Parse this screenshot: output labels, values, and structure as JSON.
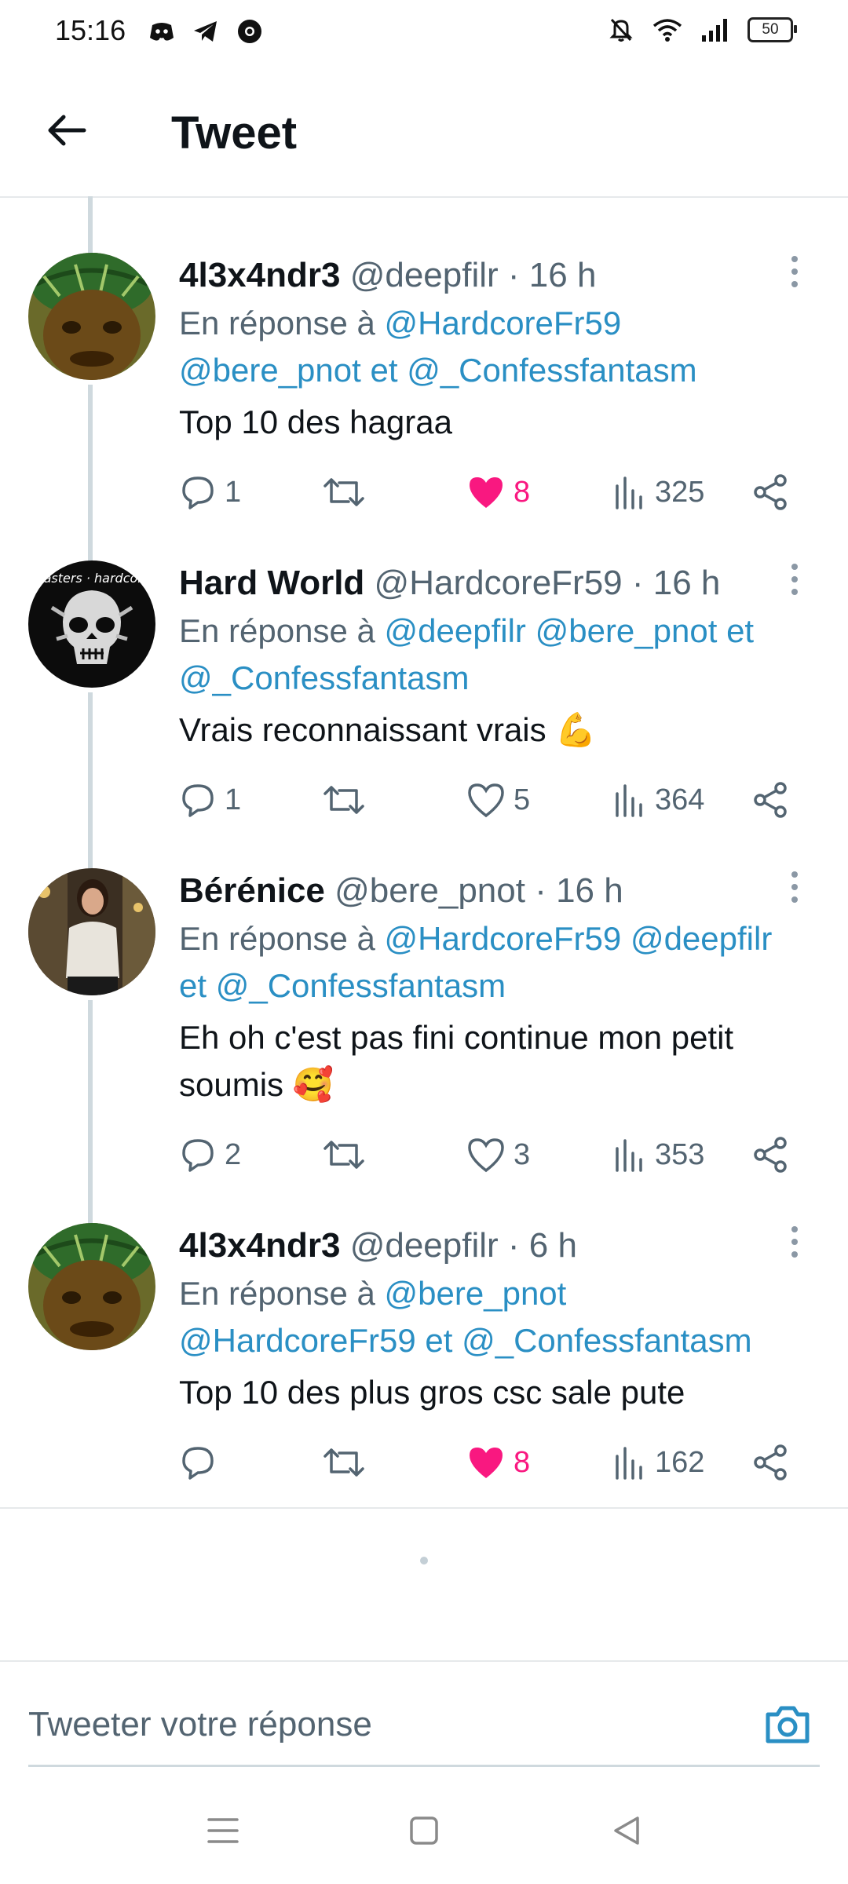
{
  "status_bar": {
    "time": "15:16",
    "battery": "50"
  },
  "header": {
    "title": "Tweet"
  },
  "tweets": [
    {
      "name": "4l3x4ndr3",
      "handle": "@deepfilr",
      "time": "· 16 h",
      "reply_prefix": "En réponse à",
      "reply_links": [
        "@HardcoreFr59",
        "@bere_pnot",
        "et",
        "@_Confessfantasm"
      ],
      "text": "Top 10 des hagraa",
      "emoji": "",
      "replies": "1",
      "likes": "8",
      "liked": true,
      "views": "325"
    },
    {
      "name": "Hard World",
      "handle": "@HardcoreFr59",
      "time": "· 16 h",
      "reply_prefix": "En réponse à",
      "reply_links": [
        "@deepfilr",
        "@bere_pnot",
        "et",
        "@_Confessfantasm"
      ],
      "text": "Vrais reconnaissant vrais",
      "emoji": "💪",
      "replies": "1",
      "likes": "5",
      "liked": false,
      "views": "364"
    },
    {
      "name": "Bérénice",
      "handle": "@bere_pnot",
      "time": "· 16 h",
      "reply_prefix": "En réponse à",
      "reply_links": [
        "@HardcoreFr59",
        "@deepfilr",
        "et",
        "@_Confessfantasm"
      ],
      "text": "Eh oh c'est pas fini continue mon petit soumis",
      "emoji": "🥰",
      "replies": "2",
      "likes": "3",
      "liked": false,
      "views": "353"
    },
    {
      "name": "4l3x4ndr3",
      "handle": "@deepfilr",
      "time": "· 6 h",
      "reply_prefix": "En réponse à",
      "reply_links": [
        "@bere_pnot",
        "@HardcoreFr59",
        "et",
        "@_Confessfantasm"
      ],
      "text": "Top 10 des plus gros csc sale pute",
      "emoji": "",
      "replies": "",
      "likes": "8",
      "liked": true,
      "views": "162"
    }
  ],
  "avatar_labels": {
    "hardworld": "masters of hardcore"
  },
  "compose": {
    "placeholder": "Tweeter votre réponse"
  },
  "colors": {
    "link": "#2a8fc4",
    "like": "#f91880",
    "muted": "#536471",
    "text": "#0f1419"
  },
  "icons": [
    "back-arrow-icon",
    "more-icon",
    "reply-icon",
    "retweet-icon",
    "like-icon",
    "views-icon",
    "share-icon",
    "camera-icon",
    "menu-icon",
    "home-square-icon",
    "back-triangle-icon"
  ]
}
